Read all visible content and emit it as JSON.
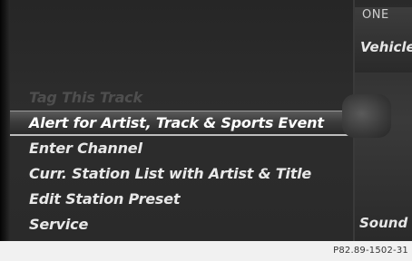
{
  "menu": {
    "items": [
      {
        "label": "Tag This Track",
        "state": "disabled"
      },
      {
        "label": "Alert for Artist, Track & Sports Event",
        "state": "selected"
      },
      {
        "label": "Enter Channel",
        "state": "normal"
      },
      {
        "label": "Curr. Station List with Artist & Title",
        "state": "normal"
      },
      {
        "label": "Edit Station Preset",
        "state": "normal"
      },
      {
        "label": "Service",
        "state": "normal"
      }
    ]
  },
  "right_panel": {
    "top_label": "ONE",
    "vehicle_label": "Vehicle",
    "sound_label": "Sound"
  },
  "caption": "P82.89-1502-31",
  "colors": {
    "menu_text": "#e8e8e8",
    "disabled_text": "#4e4e4e",
    "background": "#0b0b0b"
  }
}
